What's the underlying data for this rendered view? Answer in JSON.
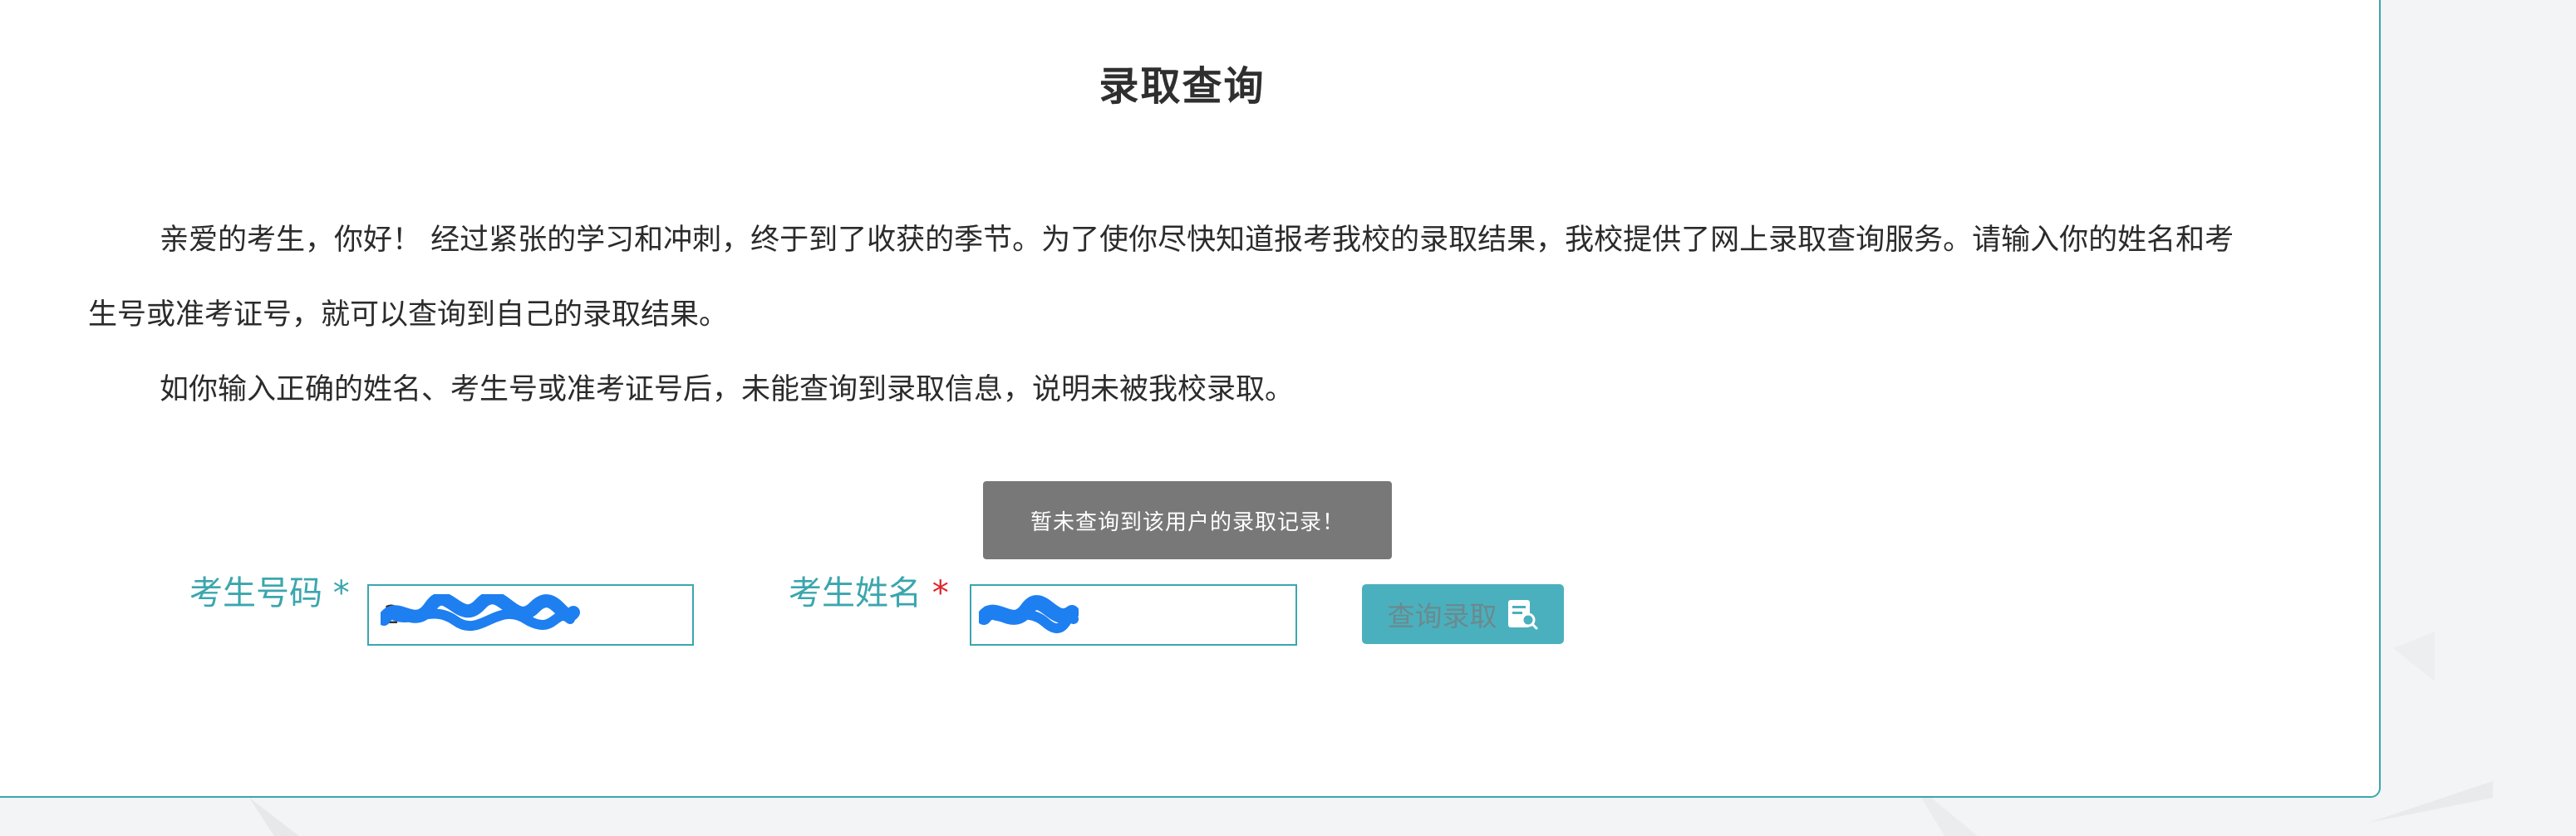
{
  "page": {
    "title": "录取查询",
    "intro_paragraphs": [
      "亲爱的考生，你好！ 经过紧张的学习和冲刺，终于到了收获的季节。为了使你尽快知道报考我校的录取结果，我校提供了网上录取查询服务。请输入你的姓名和考生号或准考证号，就可以查询到自己的录取结果。",
      "如你输入正确的姓名、考生号或准考证号后，未能查询到录取信息，说明未被我校录取。"
    ]
  },
  "toast": {
    "message": "暂未查询到该用户的录取记录！"
  },
  "form": {
    "exam_number_label": "考生号码",
    "exam_number_required": "*",
    "exam_number_value": "2",
    "name_label": "考生姓名",
    "name_required": "*",
    "name_value": "",
    "query_button_label": "查询录取",
    "query_button_icon": "document-search-icon"
  },
  "colors": {
    "accent": "#3ba6ad",
    "button_bg": "#4bb0bd",
    "required_red": "#e0242b",
    "toast_bg": "#787878",
    "redaction_blue": "#1e7ff0"
  }
}
